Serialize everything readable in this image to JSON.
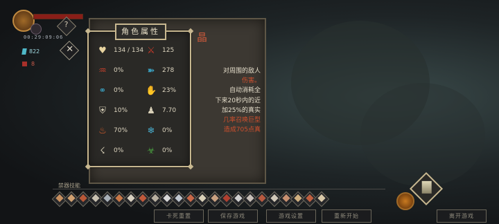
{
  "hud": {
    "timer": "00:29:09:06",
    "crystals": "822",
    "red_counter": "8",
    "help_label": "?",
    "close_label": "✕"
  },
  "scroll": {
    "title_fragment": "晶",
    "lines": [
      {
        "text": "对周围的敌人",
        "color": "w"
      },
      {
        "text": "伤害。",
        "color": "r"
      },
      {
        "text": "自动消耗全",
        "color": "w"
      },
      {
        "text": "下来20秒内的近",
        "color": "w"
      },
      {
        "text": "加25%的真实",
        "color": "w"
      },
      {
        "text": "几率召唤巨型",
        "color": "r"
      },
      {
        "text": "造成705点真",
        "color": "r"
      }
    ]
  },
  "attributes": {
    "title": "角色属性",
    "stats": [
      {
        "name": "health",
        "icon": "heart-icon",
        "value": "134 / 134",
        "color": "#e8d4a0"
      },
      {
        "name": "attack",
        "icon": "sword-icon",
        "value": "125",
        "color": "#c83a2a"
      },
      {
        "name": "crit",
        "icon": "red-claw-icon",
        "value": "0%",
        "color": "#c8402c"
      },
      {
        "name": "damage-bonus",
        "icon": "blue-wing-icon",
        "value": "278",
        "color": "#3a9ab8"
      },
      {
        "name": "crit-damage",
        "icon": "blue-chain-icon",
        "value": "0%",
        "color": "#3a9ab8"
      },
      {
        "name": "dodge",
        "icon": "hand-icon",
        "value": "23%",
        "color": "#d8d0b8"
      },
      {
        "name": "defense",
        "icon": "shield-icon",
        "value": "10%",
        "color": "#d8d0b8"
      },
      {
        "name": "speed",
        "icon": "boot-icon",
        "value": "7.70",
        "color": "#d8d0b8"
      },
      {
        "name": "fire",
        "icon": "fire-icon",
        "value": "70%",
        "color": "#e0602a"
      },
      {
        "name": "ice",
        "icon": "snowflake-icon",
        "value": "0%",
        "color": "#4ab0d0"
      },
      {
        "name": "lightning",
        "icon": "lightning-icon",
        "value": "0%",
        "color": "#d8d0b8"
      },
      {
        "name": "poison",
        "icon": "poison-icon",
        "value": "0%",
        "color": "#4aa040"
      }
    ]
  },
  "skills": {
    "label": "禁器技能",
    "items": [
      {
        "icon": "skill-icon",
        "color": "#c89060"
      },
      {
        "icon": "skill-icon",
        "color": "#d0a070"
      },
      {
        "icon": "skill-icon",
        "color": "#b85838"
      },
      {
        "icon": "skill-icon",
        "color": "#c8c0b0"
      },
      {
        "icon": "skill-icon",
        "color": "#a8b0b8"
      },
      {
        "icon": "skill-icon",
        "color": "#c87848"
      },
      {
        "icon": "skill-icon",
        "color": "#d8d0c0"
      },
      {
        "icon": "skill-icon",
        "color": "#c05a3c"
      },
      {
        "icon": "skill-icon",
        "color": "#b8b0a0"
      },
      {
        "icon": "skill-icon",
        "color": "#d8d8d8"
      },
      {
        "icon": "skill-icon",
        "color": "#c0c8d0"
      },
      {
        "icon": "skill-icon",
        "color": "#c86848"
      },
      {
        "icon": "skill-icon",
        "color": "#d8d0b8"
      },
      {
        "icon": "skill-icon",
        "color": "#c8a080"
      },
      {
        "icon": "skill-icon",
        "color": "#b04030"
      },
      {
        "icon": "skill-icon",
        "color": "#d0d0d0"
      },
      {
        "icon": "skill-icon",
        "color": "#c8c0b8"
      },
      {
        "icon": "skill-icon",
        "color": "#b85a40"
      },
      {
        "icon": "skill-icon",
        "color": "#d0c8b8"
      },
      {
        "icon": "skill-icon",
        "color": "#c89070"
      },
      {
        "icon": "skill-icon",
        "color": "#d0b080"
      },
      {
        "icon": "skill-icon",
        "color": "#c06040"
      },
      {
        "icon": "skill-icon",
        "color": "#d8c8a8"
      }
    ]
  },
  "buttons": [
    {
      "name": "rechallenge-button",
      "label": "卡死重置"
    },
    {
      "name": "save-game-button",
      "label": "保存游戏"
    },
    {
      "name": "settings-button",
      "label": "游戏设置"
    },
    {
      "name": "restart-button",
      "label": "重新开始"
    },
    {
      "name": "exit-game-button",
      "label": "离开游戏"
    }
  ]
}
